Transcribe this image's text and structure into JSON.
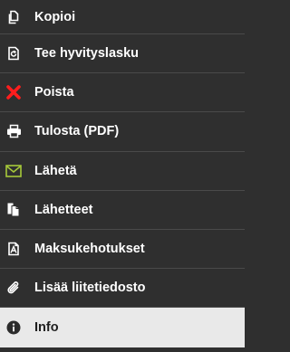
{
  "menu": {
    "items": [
      {
        "label": "Kopioi",
        "icon": "copy-icon"
      },
      {
        "label": "Tee hyvityslasku",
        "icon": "credit-note-icon"
      },
      {
        "label": "Poista",
        "icon": "delete-icon"
      },
      {
        "label": "Tulosta (PDF)",
        "icon": "print-icon"
      },
      {
        "label": "Lähetä",
        "icon": "envelope-icon"
      },
      {
        "label": "Lähetteet",
        "icon": "documents-icon"
      },
      {
        "label": "Maksukehotukset",
        "icon": "payment-reminder-icon"
      },
      {
        "label": "Lisää liitetiedosto",
        "icon": "paperclip-icon"
      },
      {
        "label": "Info",
        "icon": "info-icon"
      }
    ]
  },
  "colors": {
    "background": "#2f2f2f",
    "active_background": "#e9e9e9",
    "delete_icon": "#ff1d1d",
    "envelope_icon": "#a6c83a"
  }
}
